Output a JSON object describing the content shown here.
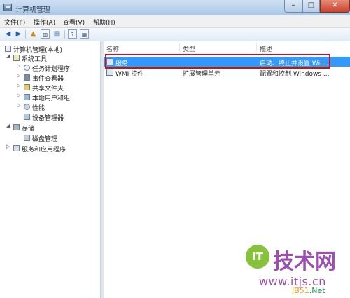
{
  "window": {
    "title": "计算机管理"
  },
  "menu": [
    "文件(F)",
    "操作(A)",
    "查看(V)",
    "帮助(H)"
  ],
  "tree": [
    {
      "label": "计算机管理(本地)",
      "arrow": "",
      "icon": "computer-icon"
    },
    {
      "label": "系统工具",
      "arrow": "◢",
      "icon": "tools-icon"
    },
    {
      "label": "任务计划程序",
      "arrow": "▷",
      "icon": "clock-icon"
    },
    {
      "label": "事件查看器",
      "arrow": "▷",
      "icon": "event-viewer-icon"
    },
    {
      "label": "共享文件夹",
      "arrow": "▷",
      "icon": "shared-folder-icon"
    },
    {
      "label": "本地用户和组",
      "arrow": "▷",
      "icon": "users-icon"
    },
    {
      "label": "性能",
      "arrow": "▷",
      "icon": "performance-icon"
    },
    {
      "label": "设备管理器",
      "arrow": "",
      "icon": "device-manager-icon"
    },
    {
      "label": "存储",
      "arrow": "◢",
      "icon": "storage-icon"
    },
    {
      "label": "磁盘管理",
      "arrow": "",
      "icon": "disk-icon"
    },
    {
      "label": "服务和应用程序",
      "arrow": "▷",
      "icon": "services-apps-icon"
    }
  ],
  "columns": [
    "名称",
    "类型",
    "描述"
  ],
  "rows": [
    {
      "name": "服务",
      "type": "",
      "desc": "启动、终止并设置 Win...",
      "selected": true
    },
    {
      "name": "WMI 控件",
      "type": "扩展管理单元",
      "desc": "配置和控制 Windows ...",
      "selected": false
    }
  ],
  "watermark": {
    "logo_text": "IT",
    "name": "技术网",
    "url": "www.itjs.cn",
    "url2_part1": "JB51",
    "url2_part2": ".Net"
  }
}
